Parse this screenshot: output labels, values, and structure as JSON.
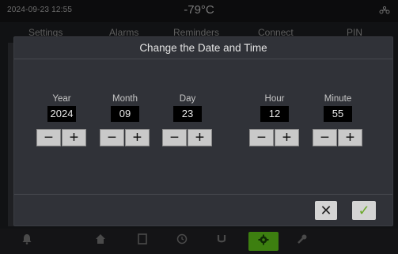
{
  "status_bar": {
    "datetime": "2024-09-23   12:55",
    "temperature": "-79°C",
    "icon": "network-icon"
  },
  "nav": {
    "tabs": [
      {
        "label": "Settings"
      },
      {
        "label": "Alarms"
      },
      {
        "label": "Reminders"
      },
      {
        "label": "Connect"
      },
      {
        "label": "PIN"
      }
    ]
  },
  "dialog": {
    "title": "Change the Date and Time",
    "fields": [
      {
        "label": "Year",
        "value": "2024"
      },
      {
        "label": "Month",
        "value": "09"
      },
      {
        "label": "Day",
        "value": "23"
      },
      {
        "label": "Hour",
        "value": "12"
      },
      {
        "label": "Minute",
        "value": "55"
      }
    ],
    "minus_label": "−",
    "plus_label": "+",
    "cancel_label": "✕",
    "confirm_label": "✓"
  },
  "bottom_bar": {
    "icons": [
      "bell-icon",
      "home-icon",
      "document-icon",
      "clock-icon",
      "magnet-icon",
      "gear-icon",
      "wrench-icon"
    ],
    "active": "gear-icon",
    "accent_color": "#3d7f10"
  }
}
